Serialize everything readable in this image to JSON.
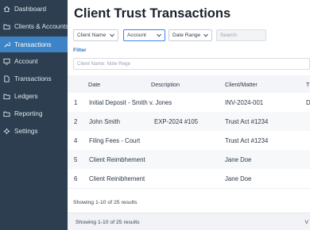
{
  "sidebar": {
    "items": [
      {
        "label": "Dashboard",
        "icon": "home-icon",
        "active": false
      },
      {
        "label": "Clients & Accounts",
        "icon": "folder-icon",
        "active": false
      },
      {
        "label": "Transactions",
        "icon": "wrench-icon",
        "active": true
      },
      {
        "label": "Account",
        "icon": "monitor-icon",
        "active": false
      },
      {
        "label": "Transactions",
        "icon": "file-icon",
        "active": false
      },
      {
        "label": "Ledgers",
        "icon": "folder-icon",
        "active": false
      },
      {
        "label": "Reporting",
        "icon": "folder-icon",
        "active": false
      },
      {
        "label": "Settings",
        "icon": "gear-icon",
        "active": false
      }
    ]
  },
  "main": {
    "title": "Client Trust Transactions",
    "filters": {
      "client_name": "Client Name",
      "account": "Account",
      "date_range": "Date Range",
      "search_placeholder": "Search"
    },
    "filter_link": "Filter",
    "name_input_placeholder": "Client Name: Note Rege",
    "table": {
      "headers": [
        "Date",
        "Description",
        "Client/Matter",
        "T"
      ],
      "rows": [
        {
          "num": "1",
          "description": "Initial Deposit - Smith v. Jones",
          "extra": "",
          "matter": "INV-2024-001",
          "t": "D"
        },
        {
          "num": "2",
          "description": "John Smith",
          "extra": "EXP-2024 #105",
          "matter": "Trust Act #1234",
          "t": ""
        },
        {
          "num": "4",
          "description": "Filing Fees - Court",
          "extra": "",
          "matter": "Trust Act #1234",
          "t": ""
        },
        {
          "num": "5",
          "description": "Client Reimbhement",
          "extra": "",
          "matter": "Jane Doe",
          "t": ""
        },
        {
          "num": "6",
          "description": "Client Reinibhement",
          "extra": "",
          "matter": "Jane Doe",
          "t": ""
        }
      ]
    },
    "footer_text": "Showing 1-10 of 25 results",
    "footer_bar_text": "Showing 1-10 of 25 results",
    "footer_bar_right": "V"
  },
  "colors": {
    "sidebar_bg": "#2c3e50",
    "active_item": "#3d84c6",
    "link": "#2f74c0"
  }
}
